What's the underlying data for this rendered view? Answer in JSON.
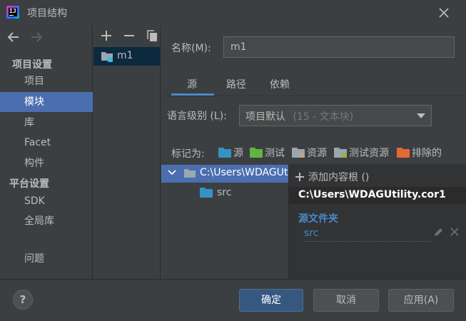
{
  "window": {
    "title": "项目结构"
  },
  "nav": {
    "section_project_settings": "项目设置",
    "items_project": [
      "项目",
      "模块",
      "库",
      "Facet",
      "构件"
    ],
    "section_platform_settings": "平台设置",
    "items_platform": [
      "SDK",
      "全局库"
    ],
    "problems": "问题",
    "selected": "模块"
  },
  "modules": {
    "items": [
      "m1"
    ]
  },
  "detail": {
    "name_label": "名称(M):",
    "name_value": "m1",
    "tabs": [
      "源",
      "路径",
      "依赖"
    ],
    "active_tab": "源",
    "language_level_label": "语言级别 (L):",
    "language_level_value": "项目默认",
    "language_level_hint": "(15 - 文本块)",
    "mark_as_label": "标记为:",
    "mark_as": [
      {
        "label": "源",
        "color": "#3592c4"
      },
      {
        "label": "测试",
        "color": "#62b543"
      },
      {
        "label": "资源",
        "color": "#9aa7b0"
      },
      {
        "label": "测试资源",
        "color": "#9aa7b0"
      },
      {
        "label": "排除的",
        "color": "#e36a35"
      }
    ],
    "tree": {
      "root": "C:\\Users\\WDAGUtilityAccount",
      "child": "src"
    },
    "content_root_panel": {
      "add_content_root": "添加内容根 ()",
      "path": "C:\\Users\\WDAGUtility.cor1",
      "source_folders_title": "源文件夹",
      "source_folder": "src"
    }
  },
  "buttons": {
    "help": "?",
    "ok": "确定",
    "cancel": "取消",
    "apply": "应用(A)"
  },
  "colors": {
    "accent": "#4b6eaf",
    "link": "#4a88c7",
    "background": "#3c3f41"
  }
}
